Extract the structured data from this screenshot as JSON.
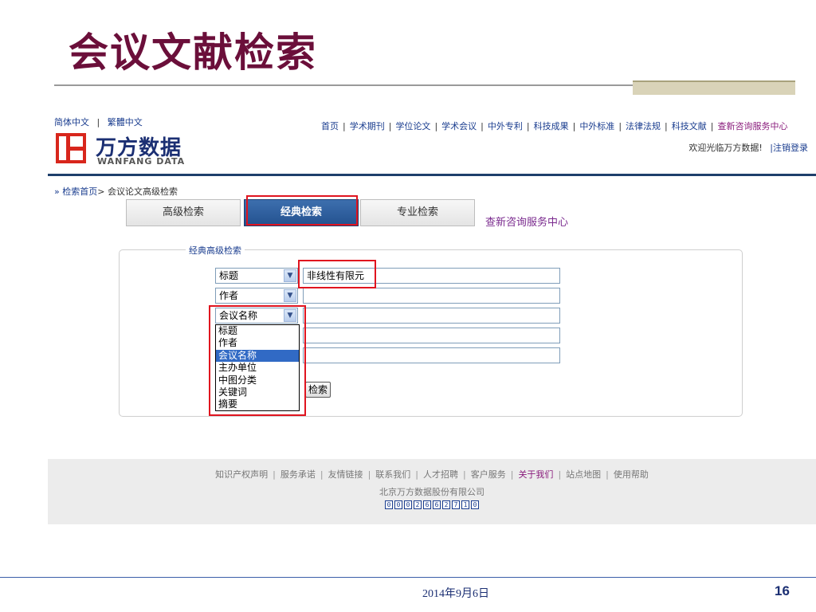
{
  "slide": {
    "title": "会议文献检索",
    "date": "2014年9月6日",
    "page_number": "16"
  },
  "site": {
    "lang": [
      "简体中文",
      "繁體中文"
    ],
    "lang_sep": "|",
    "logo_cn": "万方数据",
    "logo_en": "WANFANG DATA",
    "nav": [
      "首页",
      "学术期刊",
      "学位论文",
      "学术会议",
      "中外专利",
      "科技成果",
      "中外标准",
      "法律法规",
      "科技文献",
      "查新咨询服务中心"
    ],
    "nav_sep": "|",
    "welcome": "欢迎光临万方数据!",
    "logout": "|注销登录"
  },
  "breadcrumb": {
    "prefix": "»",
    "home": "检索首页",
    "separator": ">",
    "current": "会议论文高级检索"
  },
  "tabs": [
    "高级检索",
    "经典检索",
    "专业检索"
  ],
  "consult_link": "查新咨询服务中心",
  "form": {
    "legend": "经典高级检索",
    "rows": [
      {
        "field": "标题",
        "value": "非线性有限元"
      },
      {
        "field": "作者",
        "value": ""
      },
      {
        "field": "会议名称",
        "value": ""
      },
      {
        "field": "",
        "value": ""
      },
      {
        "field": "",
        "value": ""
      }
    ],
    "dropdown_arrow": "▼",
    "dropdown_options": [
      "标题",
      "作者",
      "会议名称",
      "主办单位",
      "中图分类",
      "关键词",
      "摘要"
    ],
    "dropdown_selected": "会议名称",
    "search_button": "检索"
  },
  "footer": {
    "links": [
      "知识产权声明",
      "服务承诺",
      "友情链接",
      "联系我们",
      "人才招聘",
      "客户服务",
      "关于我们",
      "站点地图",
      "使用帮助"
    ],
    "link_sep": "|",
    "company": "北京万方数据股份有限公司",
    "counter": [
      "0",
      "0",
      "0",
      "2",
      "6",
      "6",
      "2",
      "7",
      "1",
      "0"
    ]
  },
  "colors": {
    "title": "#6b0f3a",
    "link": "#1a3d8f",
    "highlight_box": "#e0141f",
    "active_tab": "#23518f"
  }
}
